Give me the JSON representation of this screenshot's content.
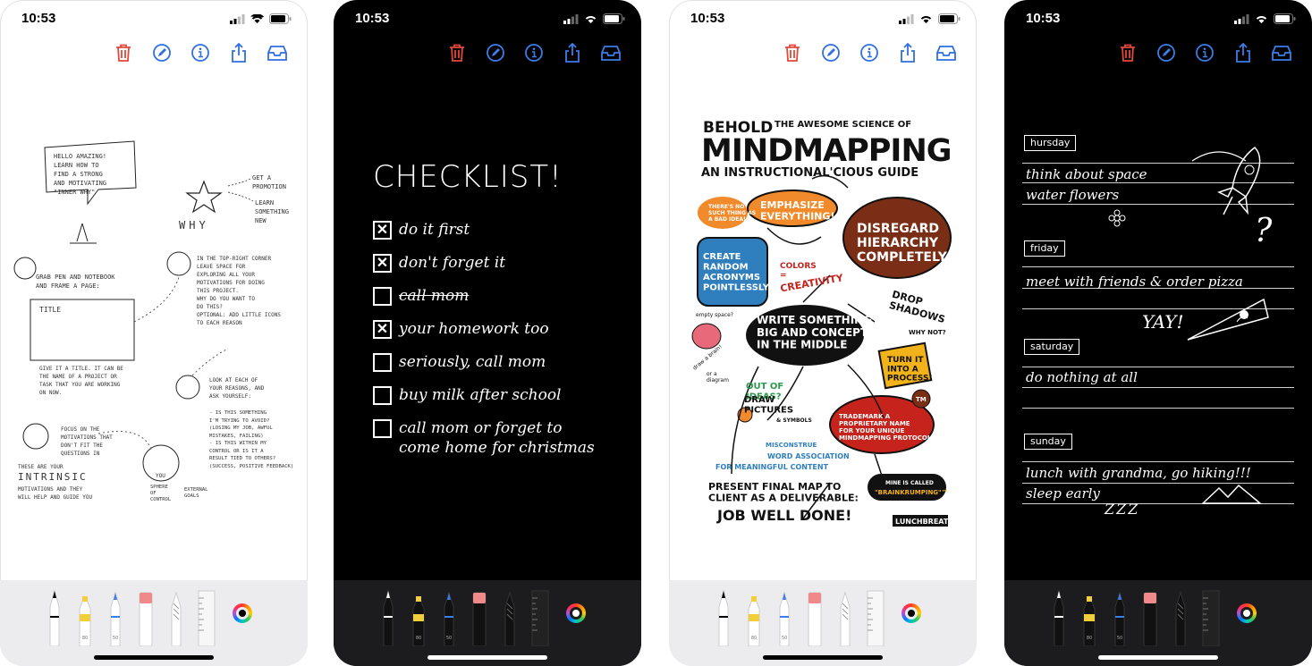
{
  "status": {
    "time": "10:53"
  },
  "toolbar": {
    "icons": [
      "trash-icon",
      "pencil-circle-icon",
      "info-icon",
      "share-icon",
      "tray-icon"
    ],
    "trash_color": "#e5473a",
    "accent": "#2f6fe0"
  },
  "screen1": {
    "notes": [
      "HELLO AMAZING!\nLEARN HOW TO\nFIND A STRONG\nAND MOTIVATING\n\"INNER WHY\"",
      "GET A\nPROMOTION",
      "LEARN\nSOMETHING\nNEW",
      "WHY",
      "GRAB PEN AND NOTEBOOK\nAND FRAME A PAGE:",
      "TITLE",
      "IN THE TOP-RIGHT CORNER\nLEAVE SPACE FOR\nEXPLORING ALL YOUR\nMOTIVATIONS FOR DOING\nTHIS PROJECT.\nWHY DO YOU WANT TO\nDO THIS?\nOPTIONAL: ADD LITTLE ICONS\nTO EACH REASON",
      "GIVE IT A TITLE. IT CAN BE\nTHE NAME OF A PROJECT OR\nTASK THAT YOU ARE WORKING\nON NOW.",
      "LOOK AT EACH OF\nYOUR REASONS, AND\nASK YOURSELF:",
      "- IS THIS SOMETHING\nI'M TRYING TO AVOID?\n(LOSING MY JOB, AWFUL\nMISTAKES, FAILING)\n- IS THIS WITHIN MY\nCONTROL OR IS IT A\nRESULT TIED TO OTHERS?\n(SUCCESS, POSITIVE FEEDBACK)",
      "FOCUS ON THE\nMOTIVATIONS THAT\nDON'T FIT THE\nQUESTIONS IN",
      "THESE ARE YOUR",
      "INTRINSIC",
      "MOTIVATIONS AND THEY\nWILL HELP AND GUIDE YOU",
      "YOU",
      "SPHERE\nOF\nCONTROL",
      "EXTERNAL\nGOALS"
    ]
  },
  "screen2": {
    "title": "CHECKLIST!",
    "items": [
      {
        "text": "do it first",
        "checked": true,
        "struck": false
      },
      {
        "text": "don't forget it",
        "checked": true,
        "struck": false
      },
      {
        "text": "call mom",
        "checked": false,
        "struck": true
      },
      {
        "text": "your homework too",
        "checked": true,
        "struck": false
      },
      {
        "text": "seriously, call mom",
        "checked": false,
        "struck": false
      },
      {
        "text": "buy milk after school",
        "checked": false,
        "struck": false
      },
      {
        "text": "call mom or forget to\ncome home for christmas",
        "checked": false,
        "struck": false
      }
    ]
  },
  "screen3": {
    "line1a": "BEHOLD",
    "line1b": "THE AWESOME SCIENCE OF",
    "line2": "MINDMAPPING",
    "line3": "AN INSTRUCTIONAL'CIOUS GUIDE",
    "bubbles": {
      "no_bad": "THERE'S NO\nSUCH THING AS\nA BAD IDEA!",
      "emphasize": "EMPHASIZE\nEVERYTHING!",
      "disregard": "DISREGARD\nHIERARCHY\nCOMPLETELY!",
      "acronyms": "CREATE\nRANDOM\nACRONYMS\nPOINTLESSLY",
      "colors": "COLORS\n=",
      "creativity": "CREATIVITY",
      "drop": "DROP\nSHADOWS",
      "why_not": "WHY NOT?",
      "empty": "empty space?",
      "draw_brain": "draw a brain!",
      "or_diagram": "or a\ndiagram",
      "center": "WRITE SOMETHING\nBIG AND CONCEPTUAL\nIN THE MIDDLE",
      "turn": "TURN IT\nINTO A\nPROCESS!",
      "out_of_ideas": "OUT OF\nIDEAS?",
      "draw_pictures": "DRAW\nPICTURES",
      "symbols": "& SYMBOLS",
      "tm": "TM",
      "trademark": "TRADEMARK A\nPROPRIETARY NAME\nFOR YOUR UNIQUE\nMINDMAPPING PROTOCOL!",
      "misconstrue": "MISCONSTRUE",
      "word_assoc": "WORD ASSOCIATION",
      "meaningful": "FOR MEANINGFUL CONTENT",
      "present": "PRESENT FINAL MAP TO\nCLIENT AS A DELIVERABLE:",
      "job": "JOB WELL DONE!",
      "mine": "MINE IS CALLED",
      "brainkrumping": "\"BRAINKRUMPING\"™",
      "signature": "LUNCHBREATH"
    },
    "colors": {
      "orange": "#f08a2a",
      "blue": "#2f7fbf",
      "brown": "#7b2e16",
      "red": "#c5231c",
      "yellow": "#f2b21a",
      "green": "#2c9a4a"
    }
  },
  "screen4": {
    "days": [
      {
        "label": "hursday",
        "entries": [
          "think about space",
          "water flowers"
        ]
      },
      {
        "label": "friday",
        "entries": [
          "meet with friends & order pizza"
        ]
      },
      {
        "label": "saturday",
        "entries": [
          "do nothing at all"
        ]
      },
      {
        "label": "sunday",
        "entries": [
          "lunch with grandma, go hiking!!!",
          "sleep early"
        ]
      }
    ],
    "yay": "YAY!",
    "zzz": "ZZZ",
    "question": "?"
  },
  "tray": {
    "tools": [
      "pen-tool",
      "marker-tool",
      "pencil-tool",
      "eraser-tool",
      "lasso-tool",
      "ruler-tool"
    ],
    "tool_labels": [
      "",
      "80",
      "50",
      "",
      "",
      ""
    ],
    "marker_color": "#f2cd3c",
    "pencil_color": "#3b7ee8",
    "eraser_color": "#f08a8a"
  }
}
